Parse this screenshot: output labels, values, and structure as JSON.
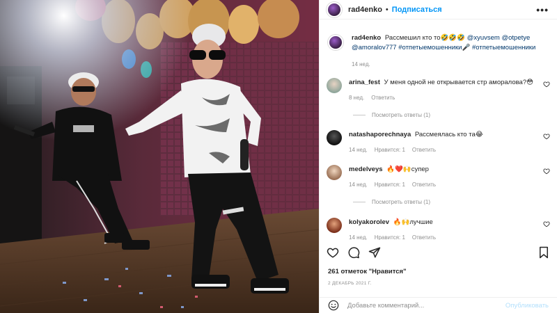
{
  "post": {
    "username": "rad4enko",
    "follow_label": "Подписаться",
    "more_label": "•••"
  },
  "caption": {
    "username": "rad4enko",
    "text": "Рассмешил кто то🤣🤣🤣",
    "mentions": [
      "@xyuvsem",
      "@otpetye",
      "@amoralov777"
    ],
    "hashtag1": "#отпетыемошенники",
    "hashtag2": "#отпетыемошенники",
    "time": "14 нед."
  },
  "comments": [
    {
      "username": "arina_fest",
      "text": "У меня одной не открывается стр аморалова?😳",
      "time": "8 нед.",
      "likes": "",
      "reply": "Ответить",
      "replies": "Посмотреть ответы (1)",
      "avatar_color": "#b9c9c2"
    },
    {
      "username": "natashaporechnaya",
      "text": "Рассмеялась кто та😂",
      "time": "14 нед.",
      "likes": "Нравится: 1",
      "reply": "Ответить",
      "replies": "",
      "avatar_color": "#2b2b2b"
    },
    {
      "username": "medelveys",
      "text": "🔥❤️🙌супер",
      "time": "14 нед.",
      "likes": "Нравится: 1",
      "reply": "Ответить",
      "replies": "Посмотреть ответы (1)",
      "avatar_color": "#c8a58a"
    },
    {
      "username": "kolyakorolev",
      "text": "🔥🙌лучшие",
      "time": "14 нед.",
      "likes": "Нравится: 1",
      "reply": "Ответить",
      "replies": "",
      "avatar_color": "#a04a2c"
    }
  ],
  "actions": {
    "like_icon": "heart-icon",
    "comment_icon": "comment-icon",
    "share_icon": "share-icon",
    "save_icon": "bookmark-icon"
  },
  "likes_text": "261 отметок \"Нравится\"",
  "date": "2 ДЕКАБРЬ 2021 Г.",
  "add_comment": {
    "placeholder": "Добавьте комментарий...",
    "publish_label": "Опубликовать"
  },
  "colors": {
    "link": "#0095f6",
    "tag": "#00376b",
    "muted": "#8e8e8e",
    "publish_disabled": "#b2dffc"
  }
}
